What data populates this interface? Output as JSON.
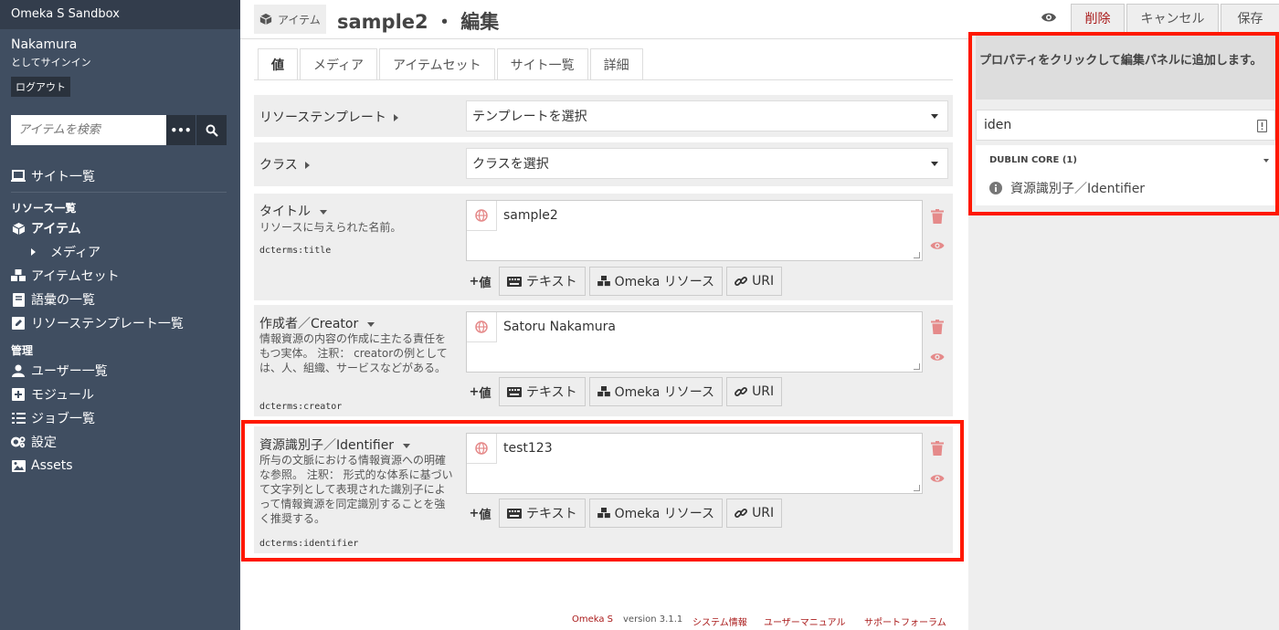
{
  "sidebar": {
    "site_name": "Omeka S Sandbox",
    "username": "Nakamura",
    "signed_in_as": "としてサインイン",
    "logout": "ログアウト",
    "search_placeholder": "アイテムを検索",
    "search_more": "•••",
    "nav_sites": "サイト一覧",
    "section_resources": "リソース一覧",
    "nav_items": "アイテム",
    "nav_media": "メディア",
    "nav_item_sets": "アイテムセット",
    "nav_vocabularies": "語彙の一覧",
    "nav_templates": "リソーステンプレート一覧",
    "section_admin": "管理",
    "nav_users": "ユーザー一覧",
    "nav_modules": "モジュール",
    "nav_jobs": "ジョブ一覧",
    "nav_settings": "設定",
    "nav_assets": "Assets"
  },
  "header": {
    "resource_type": "アイテム",
    "title": "sample2 ・ 編集",
    "delete": "削除",
    "cancel": "キャンセル",
    "save": "保存"
  },
  "tabs": [
    "値",
    "メディア",
    "アイテムセット",
    "サイト一覧",
    "詳細"
  ],
  "form": {
    "template_label": "リソーステンプレート",
    "template_select": "テンプレートを選択",
    "class_label": "クラス",
    "class_select": "クラスを選択",
    "add_value": "値",
    "btn_text": "テキスト",
    "btn_resource": "Omeka リソース",
    "btn_uri": "URI",
    "properties": [
      {
        "name": "タイトル",
        "desc": "リソースに与えられた名前。",
        "term": "dcterms:title",
        "value": "sample2"
      },
      {
        "name": "作成者／Creator",
        "desc": "情報資源の内容の作成に主たる責任をもつ実体。 注釈： creatorの例としては、人、組織、サービスなどがある。",
        "term": "dcterms:creator",
        "value": "Satoru Nakamura"
      },
      {
        "name": "資源識別子／Identifier",
        "desc": "所与の文脈における情報資源への明確な参照。 注釈： 形式的な体系に基づいて文字列として表現された識別子によって情報資源を同定識別することを強く推奨する。",
        "term": "dcterms:identifier",
        "value": "test123"
      }
    ]
  },
  "footer": {
    "brand": "Omeka S",
    "version": "version 3.1.1",
    "system_info": "システム情報",
    "user_manual": "ユーザーマニュアル",
    "support_forum": "サポートフォーラム"
  },
  "property_panel": {
    "instruction": "プロパティをクリックして編集パネルに追加します。",
    "filter_value": "iden",
    "group_title": "DUBLIN CORE (1)",
    "result": "資源識別子／Identifier"
  },
  "colors": {
    "sidebar_bg": "#404e61",
    "sidebar_header_bg": "#333d4c",
    "accent_red": "#a91919",
    "highlight": "#ff1800"
  }
}
